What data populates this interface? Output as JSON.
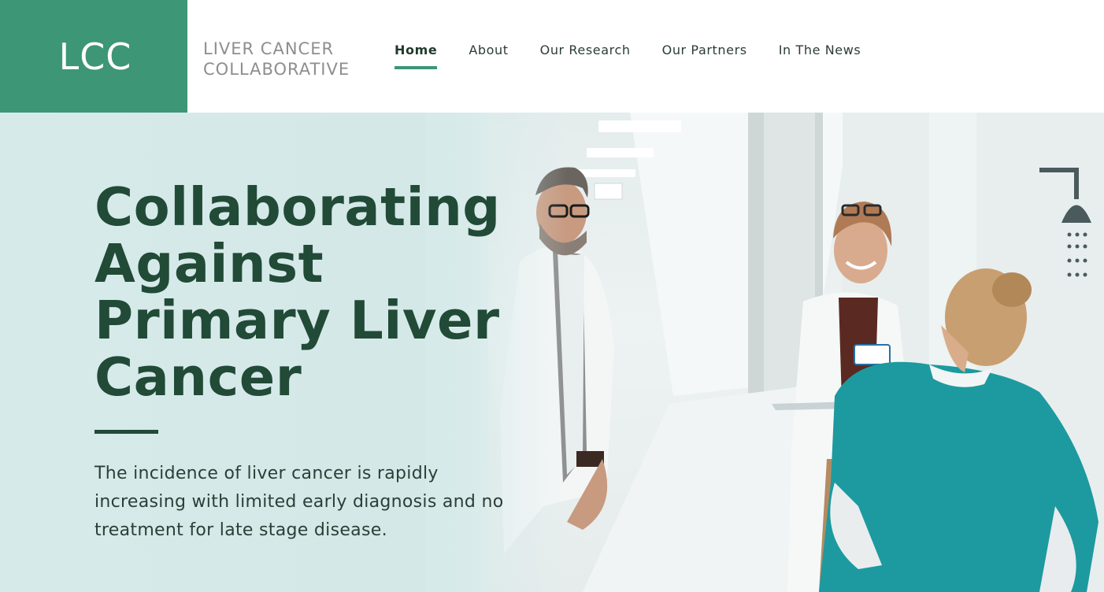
{
  "logo": {
    "mark": "LCC",
    "line1": "LIVER CANCER",
    "line2": "COLLABORATIVE"
  },
  "nav": {
    "items": [
      {
        "label": "Home",
        "active": true
      },
      {
        "label": "About"
      },
      {
        "label": "Our Research"
      },
      {
        "label": "Our Partners"
      },
      {
        "label": "In The News"
      }
    ]
  },
  "hero": {
    "title": "Collaborating Against Primary Liver Cancer",
    "description": "The incidence of liver cancer is rapidly increasing with limited early diagnosis and no treatment for late stage disease."
  },
  "colors": {
    "brand_green": "#3d9676",
    "heading_dark_green": "#214a37",
    "scrubs_teal": "#1c9aa0"
  }
}
